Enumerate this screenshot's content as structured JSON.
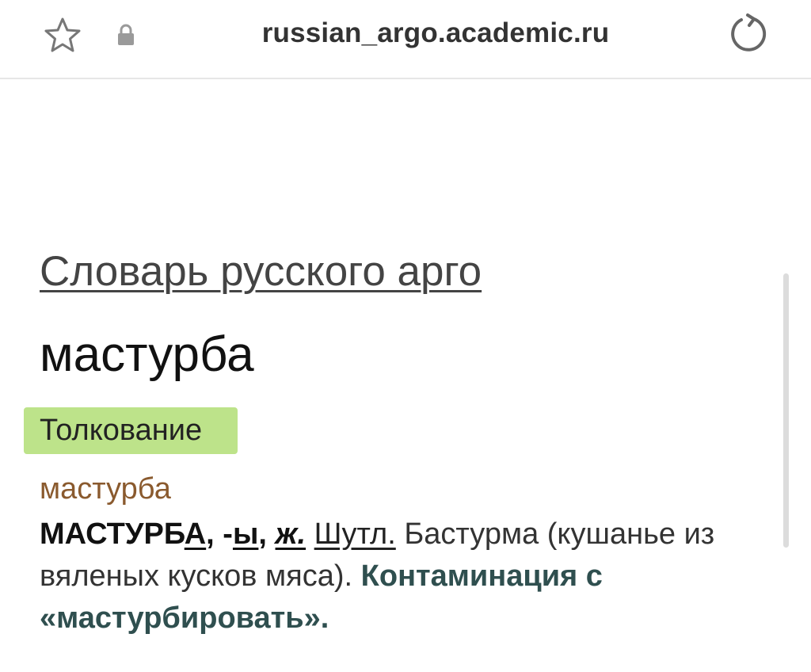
{
  "browser": {
    "url": "russian_argo.academic.ru"
  },
  "page": {
    "site_title": "Словарь русского арго",
    "headword": "мастурба",
    "tab_label": "Толкование",
    "entry_word": "мастурба",
    "definition": {
      "head_main": "МАСТУРБ",
      "head_stress": "А",
      "sep1": ", -",
      "gen_ending": "ы",
      "sep2": ", ",
      "gender": "ж.",
      "space1": " ",
      "label": "Шутл.",
      "meaning": " Бастурма (кушанье из вяленых кусков мяса). ",
      "contamination": "Контаминация с «мастурбировать»."
    }
  },
  "colors": {
    "tab_badge": "#bde38a",
    "entry_word": "#8a5a2e",
    "contamination": "#2f4f4f"
  },
  "icons": [
    "star-icon",
    "lock-icon",
    "reload-icon"
  ]
}
